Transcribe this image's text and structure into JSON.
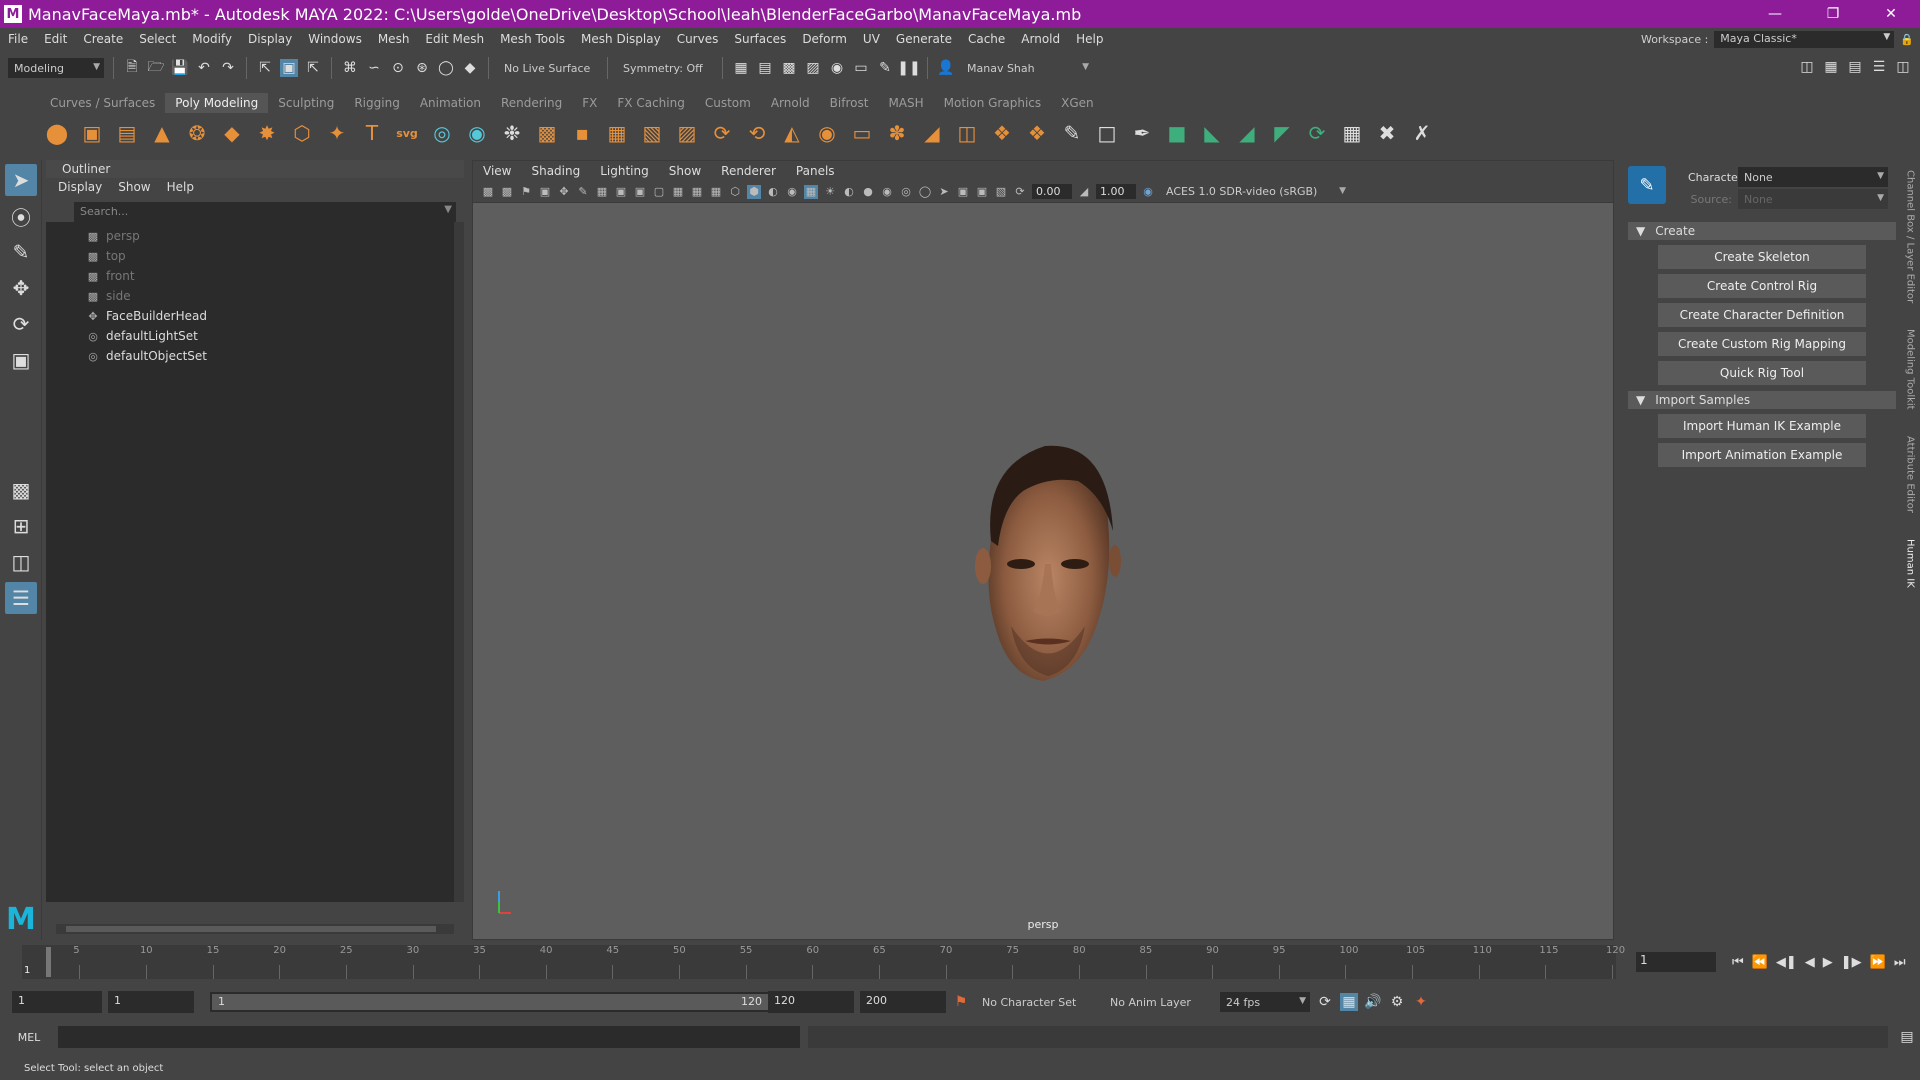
{
  "window": {
    "title": "ManavFaceMaya.mb* - Autodesk MAYA 2022: C:\\Users\\golde\\OneDrive\\Desktop\\School\\leah\\BlenderFaceGarbo\\ManavFaceMaya.mb",
    "app_logo": "M"
  },
  "menus": [
    "File",
    "Edit",
    "Create",
    "Select",
    "Modify",
    "Display",
    "Windows",
    "Mesh",
    "Edit Mesh",
    "Mesh Tools",
    "Mesh Display",
    "Curves",
    "Surfaces",
    "Deform",
    "UV",
    "Generate",
    "Cache",
    "Arnold",
    "Help"
  ],
  "workspace": {
    "label": "Workspace :",
    "value": "Maya Classic*"
  },
  "statusline": {
    "menuset": "Modeling",
    "live_surface": "No Live Surface",
    "symmetry": "Symmetry: Off",
    "user": "Manav Shah"
  },
  "shelf_tabs": [
    "Curves / Surfaces",
    "Poly Modeling",
    "Sculpting",
    "Rigging",
    "Animation",
    "Rendering",
    "FX",
    "FX Caching",
    "Custom",
    "Arnold",
    "Bifrost",
    "MASH",
    "Motion Graphics",
    "XGen"
  ],
  "active_shelf": "Poly Modeling",
  "outliner": {
    "title": "Outliner",
    "menu": [
      "Display",
      "Show",
      "Help"
    ],
    "search_placeholder": "Search...",
    "items": [
      {
        "label": "persp",
        "icon": "camera-icon",
        "dim": true
      },
      {
        "label": "top",
        "icon": "camera-icon",
        "dim": true
      },
      {
        "label": "front",
        "icon": "camera-icon",
        "dim": true
      },
      {
        "label": "side",
        "icon": "camera-icon",
        "dim": true
      },
      {
        "label": "FaceBuilderHead",
        "icon": "transform-icon",
        "dim": false
      },
      {
        "label": "defaultLightSet",
        "icon": "set-icon",
        "dim": false
      },
      {
        "label": "defaultObjectSet",
        "icon": "set-icon",
        "dim": false
      }
    ]
  },
  "viewport": {
    "menu": [
      "View",
      "Shading",
      "Lighting",
      "Show",
      "Renderer",
      "Panels"
    ],
    "exposure": "0.00",
    "gamma": "1.00",
    "color_transform": "ACES 1.0 SDR-video (sRGB)",
    "camera": "persp"
  },
  "humanik": {
    "character_label": "Character:",
    "character_value": "None",
    "source_label": "Source:",
    "source_value": "None",
    "create_header": "Create",
    "create_buttons": [
      "Create Skeleton",
      "Create Control Rig",
      "Create Character Definition",
      "Create Custom Rig Mapping",
      "Quick Rig Tool"
    ],
    "import_header": "Import Samples",
    "import_buttons": [
      "Import Human IK Example",
      "Import Animation Example"
    ]
  },
  "side_tabs": [
    "Channel Box / Layer Editor",
    "Modeling Toolkit",
    "Attribute Editor",
    "Human IK"
  ],
  "time_slider": {
    "ticks": [
      "5",
      "10",
      "15",
      "20",
      "25",
      "30",
      "35",
      "40",
      "45",
      "50",
      "55",
      "60",
      "65",
      "70",
      "75",
      "80",
      "85",
      "90",
      "95",
      "100",
      "105",
      "110",
      "115",
      "120"
    ],
    "start_label": "1",
    "current_frame": "1"
  },
  "range": {
    "anim_start": "1",
    "play_start": "1",
    "slider_start": "1",
    "slider_end": "120",
    "play_end": "120",
    "anim_end": "200",
    "character_set": "No Character Set",
    "anim_layer": "No Anim Layer",
    "fps": "24 fps"
  },
  "command_line": {
    "language": "MEL"
  },
  "help_line": "Select Tool: select an object",
  "colors": {
    "titlebar": "#8e1c99",
    "accent_blue": "#5285a6",
    "shelf_orange": "#e7903a"
  }
}
